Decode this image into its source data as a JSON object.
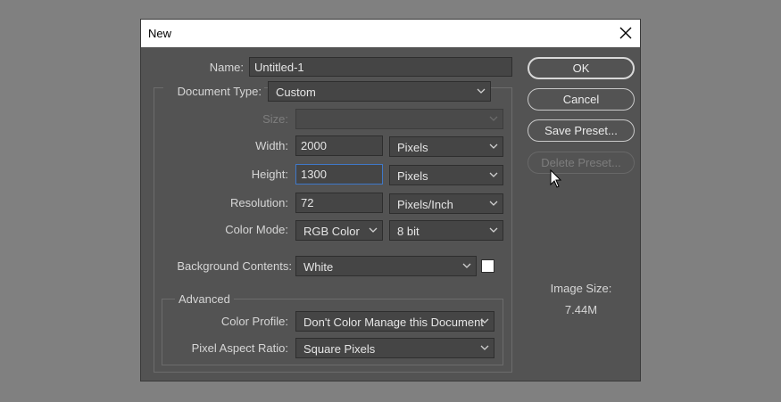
{
  "dialog": {
    "title": "New",
    "close_icon": "close-icon"
  },
  "name": {
    "label": "Name:",
    "value": "Untitled-1"
  },
  "document_type": {
    "label": "Document Type:",
    "value": "Custom"
  },
  "size": {
    "label": "Size:",
    "value": ""
  },
  "width": {
    "label": "Width:",
    "value": "2000",
    "unit": "Pixels"
  },
  "height": {
    "label": "Height:",
    "value": "1300",
    "unit": "Pixels"
  },
  "resolution": {
    "label": "Resolution:",
    "value": "72",
    "unit": "Pixels/Inch"
  },
  "color_mode": {
    "label": "Color Mode:",
    "value": "RGB Color",
    "depth": "8 bit"
  },
  "background_contents": {
    "label": "Background Contents:",
    "value": "White",
    "swatch_color": "#ffffff"
  },
  "advanced": {
    "title": "Advanced",
    "color_profile": {
      "label": "Color Profile:",
      "value": "Don't Color Manage this Document"
    },
    "pixel_aspect_ratio": {
      "label": "Pixel Aspect Ratio:",
      "value": "Square Pixels"
    }
  },
  "buttons": {
    "ok": "OK",
    "cancel": "Cancel",
    "save_preset": "Save Preset...",
    "delete_preset": "Delete Preset..."
  },
  "image_size": {
    "label": "Image Size:",
    "value": "7.44M"
  },
  "colors": {
    "background": "#808080",
    "dialog": "#535353",
    "focus": "#3f78c8"
  }
}
